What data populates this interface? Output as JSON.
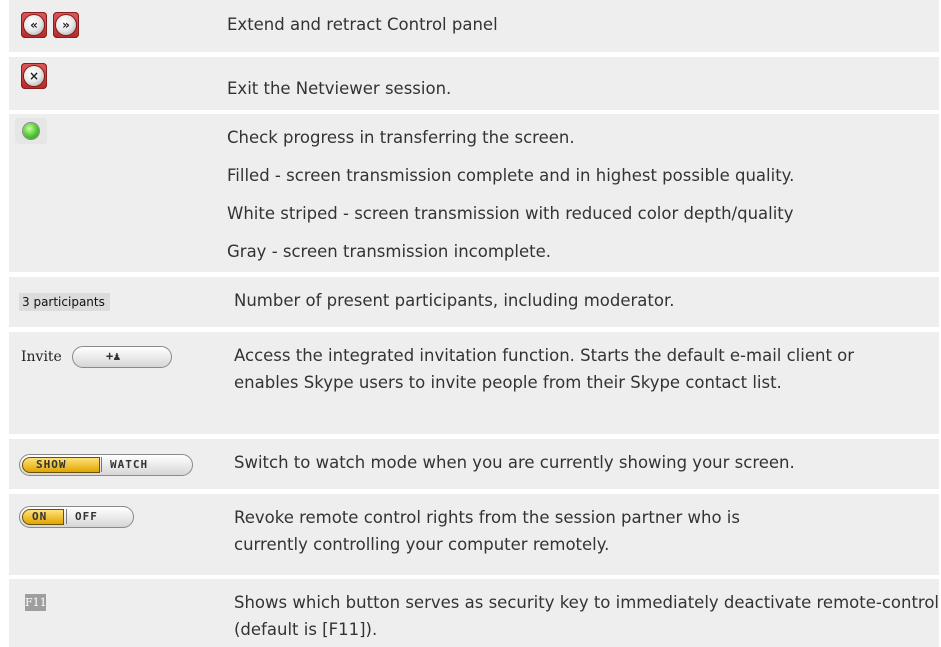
{
  "rows": [
    {
      "icon_names": [
        "retract-arrow-icon",
        "extend-arrow-icon"
      ],
      "icon_glyphs": [
        "«",
        "»"
      ],
      "lines": [
        "Extend and retract Control panel"
      ]
    },
    {
      "icon_names": [
        "exit-session-icon"
      ],
      "icon_glyphs": [
        "×"
      ],
      "lines": [
        "Exit the Netviewer session."
      ]
    },
    {
      "icon_names": [
        "transfer-progress-indicator-icon"
      ],
      "lines": [
        "Check progress in transferring the screen.",
        "Filled - screen transmission complete and in highest possible quality.",
        "White striped - screen transmission with reduced color depth/quality",
        "Gray - screen transmission incomplete."
      ]
    },
    {
      "widget": {
        "text": "3 participants"
      },
      "lines": [
        "Number of present participants, including moderator."
      ]
    },
    {
      "widget": {
        "label": "Invite",
        "button_text": "+♟"
      },
      "lines": [
        "Access the integrated invitation function. Starts the default e-mail client or enables Skype users to invite people from their Skype contact list."
      ]
    },
    {
      "widget": {
        "left": "SHOW",
        "right": "WATCH"
      },
      "lines": [
        "Switch to watch mode when you are currently showing your screen."
      ]
    },
    {
      "widget": {
        "left": "ON",
        "right": "OFF"
      },
      "lines": [
        "Revoke remote control rights from the session partner who is currently controlling your computer remotely."
      ]
    },
    {
      "widget": {
        "text": "F11"
      },
      "lines": [
        "Shows which button serves as security key to immediately deactivate remote-control (default is [F11])."
      ]
    }
  ],
  "colors": {
    "row_bg": "#eeeeee",
    "text": "#333333",
    "button_red": "#c43a3a",
    "toggle_yellow": "#f2c200",
    "indicator_green": "#4ec530"
  }
}
